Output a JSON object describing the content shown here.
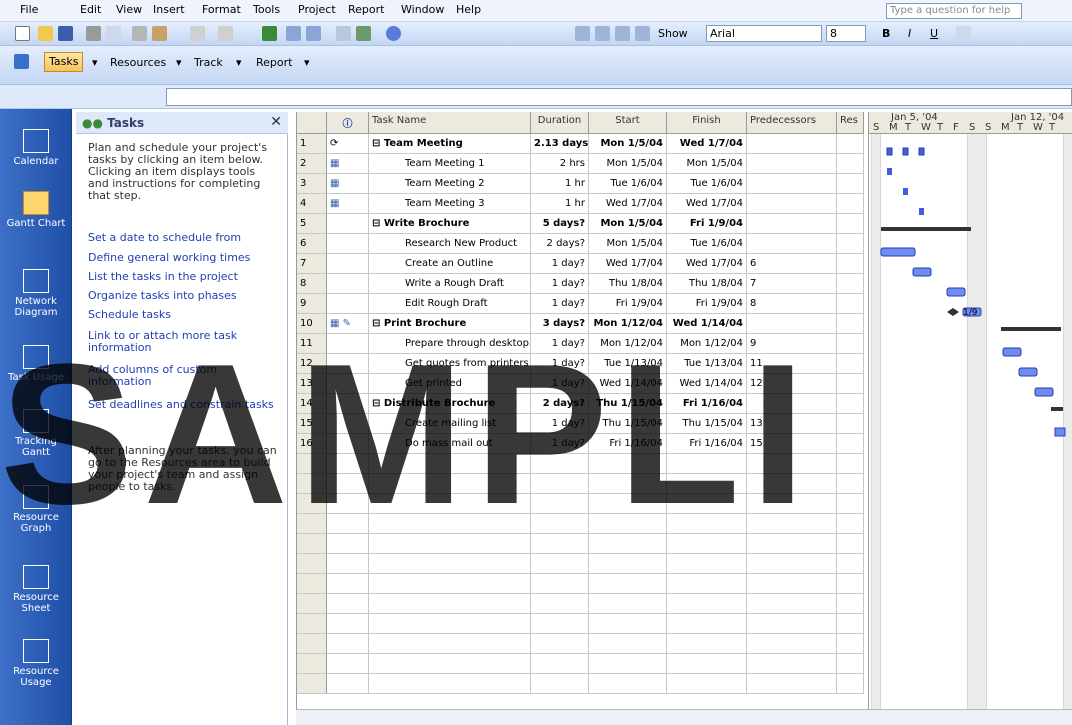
{
  "menu": {
    "items": [
      "File",
      "Edit",
      "View",
      "Insert",
      "Format",
      "Tools",
      "Project",
      "Report",
      "Window",
      "Help"
    ],
    "help_placeholder": "Type a question for help"
  },
  "toolbar": {
    "show_label": "Show",
    "font": "Arial",
    "size": "8",
    "bold": "B",
    "italic": "I",
    "underline": "U"
  },
  "guide": {
    "tasks": "Tasks",
    "resources": "Resources",
    "track": "Track",
    "report": "Report"
  },
  "views": [
    "Calendar",
    "Gantt Chart",
    "Network Diagram",
    "Task Usage",
    "Tracking Gantt",
    "Resource Graph",
    "Resource Sheet",
    "Resource Usage"
  ],
  "task_pane": {
    "title": "Tasks",
    "intro": "Plan and schedule your project's tasks by clicking an item below. Clicking an item displays tools and instructions for completing that step.",
    "links": [
      "Set a date to schedule from",
      "Define general working times",
      "List the tasks in the project",
      "Organize tasks into phases",
      "Schedule tasks",
      "Link to or attach more task information",
      "Add columns of custom information",
      "Set deadlines and constrain tasks"
    ],
    "footer": "After planning your tasks, you can go to the Resources area to build your project's team and assign people to tasks."
  },
  "table": {
    "headers": [
      "Task Name",
      "Duration",
      "Start",
      "Finish",
      "Predecessors",
      "Res"
    ],
    "rows": [
      {
        "id": "1",
        "name": "Team Meeting",
        "dur": "2.13 days",
        "start": "Mon 1/5/04",
        "finish": "Wed 1/7/04",
        "pred": "",
        "summary": true
      },
      {
        "id": "2",
        "name": "Team Meeting 1",
        "dur": "2 hrs",
        "start": "Mon 1/5/04",
        "finish": "Mon 1/5/04",
        "pred": "",
        "summary": false
      },
      {
        "id": "3",
        "name": "Team Meeting 2",
        "dur": "1 hr",
        "start": "Tue 1/6/04",
        "finish": "Tue 1/6/04",
        "pred": "",
        "summary": false
      },
      {
        "id": "4",
        "name": "Team Meeting 3",
        "dur": "1 hr",
        "start": "Wed 1/7/04",
        "finish": "Wed 1/7/04",
        "pred": "",
        "summary": false
      },
      {
        "id": "5",
        "name": "Write Brochure",
        "dur": "5 days?",
        "start": "Mon 1/5/04",
        "finish": "Fri 1/9/04",
        "pred": "",
        "summary": true
      },
      {
        "id": "6",
        "name": "Research New Product",
        "dur": "2 days?",
        "start": "Mon 1/5/04",
        "finish": "Tue 1/6/04",
        "pred": "",
        "summary": false
      },
      {
        "id": "7",
        "name": "Create an Outline",
        "dur": "1 day?",
        "start": "Wed 1/7/04",
        "finish": "Wed 1/7/04",
        "pred": "6",
        "summary": false
      },
      {
        "id": "8",
        "name": "Write a Rough Draft",
        "dur": "1 day?",
        "start": "Thu 1/8/04",
        "finish": "Thu 1/8/04",
        "pred": "7",
        "summary": false
      },
      {
        "id": "9",
        "name": "Edit Rough Draft",
        "dur": "1 day?",
        "start": "Fri 1/9/04",
        "finish": "Fri 1/9/04",
        "pred": "8",
        "summary": false
      },
      {
        "id": "10",
        "name": "Print Brochure",
        "dur": "3 days?",
        "start": "Mon 1/12/04",
        "finish": "Wed 1/14/04",
        "pred": "",
        "summary": true
      },
      {
        "id": "11",
        "name": "Prepare through desktop",
        "dur": "1 day?",
        "start": "Mon 1/12/04",
        "finish": "Mon 1/12/04",
        "pred": "9",
        "summary": false
      },
      {
        "id": "12",
        "name": "Get quotes from printers",
        "dur": "1 day?",
        "start": "Tue 1/13/04",
        "finish": "Tue 1/13/04",
        "pred": "11",
        "summary": false
      },
      {
        "id": "13",
        "name": "Get printed",
        "dur": "1 day?",
        "start": "Wed 1/14/04",
        "finish": "Wed 1/14/04",
        "pred": "12",
        "summary": false
      },
      {
        "id": "14",
        "name": "Distribute Brochure",
        "dur": "2 days?",
        "start": "Thu 1/15/04",
        "finish": "Fri 1/16/04",
        "pred": "",
        "summary": true
      },
      {
        "id": "15",
        "name": "Create mailing list",
        "dur": "1 day?",
        "start": "Thu 1/15/04",
        "finish": "Thu 1/15/04",
        "pred": "13",
        "summary": false
      },
      {
        "id": "16",
        "name": "Do mass mail out",
        "dur": "1 day?",
        "start": "Fri 1/16/04",
        "finish": "Fri 1/16/04",
        "pred": "15",
        "summary": false
      }
    ]
  },
  "gantt": {
    "week1": "Jan 5, '04",
    "week2": "Jan 12, '04",
    "days": [
      "S",
      "M",
      "T",
      "W",
      "T",
      "F",
      "S",
      "S",
      "M",
      "T",
      "W",
      "T"
    ],
    "milestone_label": "1/9"
  },
  "watermark": "SAMPLI"
}
